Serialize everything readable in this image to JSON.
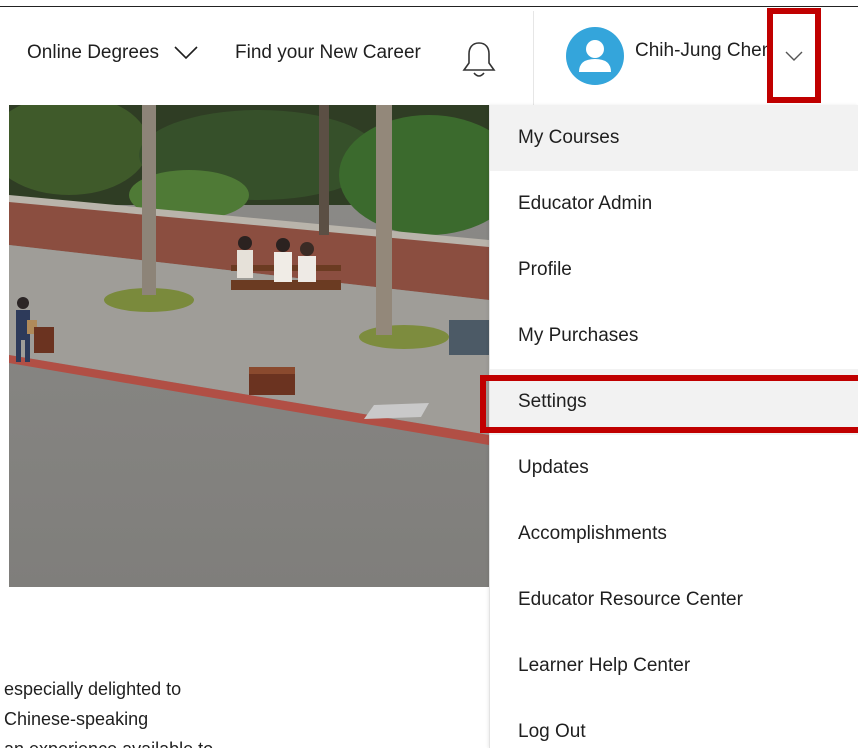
{
  "header": {
    "nav": [
      {
        "label": "Online Degrees",
        "has_dropdown": true
      },
      {
        "label": "Find your New Career",
        "has_dropdown": false
      }
    ],
    "notification_icon": "bell-icon",
    "account": {
      "user_name": "Chih-Jung Chen",
      "avatar_icon": "user-avatar-icon",
      "dropdown_icon": "chevron-down-icon"
    }
  },
  "dropdown_menu": {
    "items": [
      {
        "label": "My Courses"
      },
      {
        "label": "Educator Admin"
      },
      {
        "label": "Profile"
      },
      {
        "label": "My Purchases"
      },
      {
        "label": "Settings"
      },
      {
        "label": "Updates"
      },
      {
        "label": "Accomplishments"
      },
      {
        "label": "Educator Resource Center"
      },
      {
        "label": "Learner Help Center"
      },
      {
        "label": "Log Out"
      }
    ],
    "highlighted_item": "Settings"
  },
  "content": {
    "text_lines": [
      "especially delighted to",
      "Chinese-speaking",
      "an experience available to"
    ]
  },
  "annotation_color": "#c00000",
  "avatar_color": "#34a5db"
}
